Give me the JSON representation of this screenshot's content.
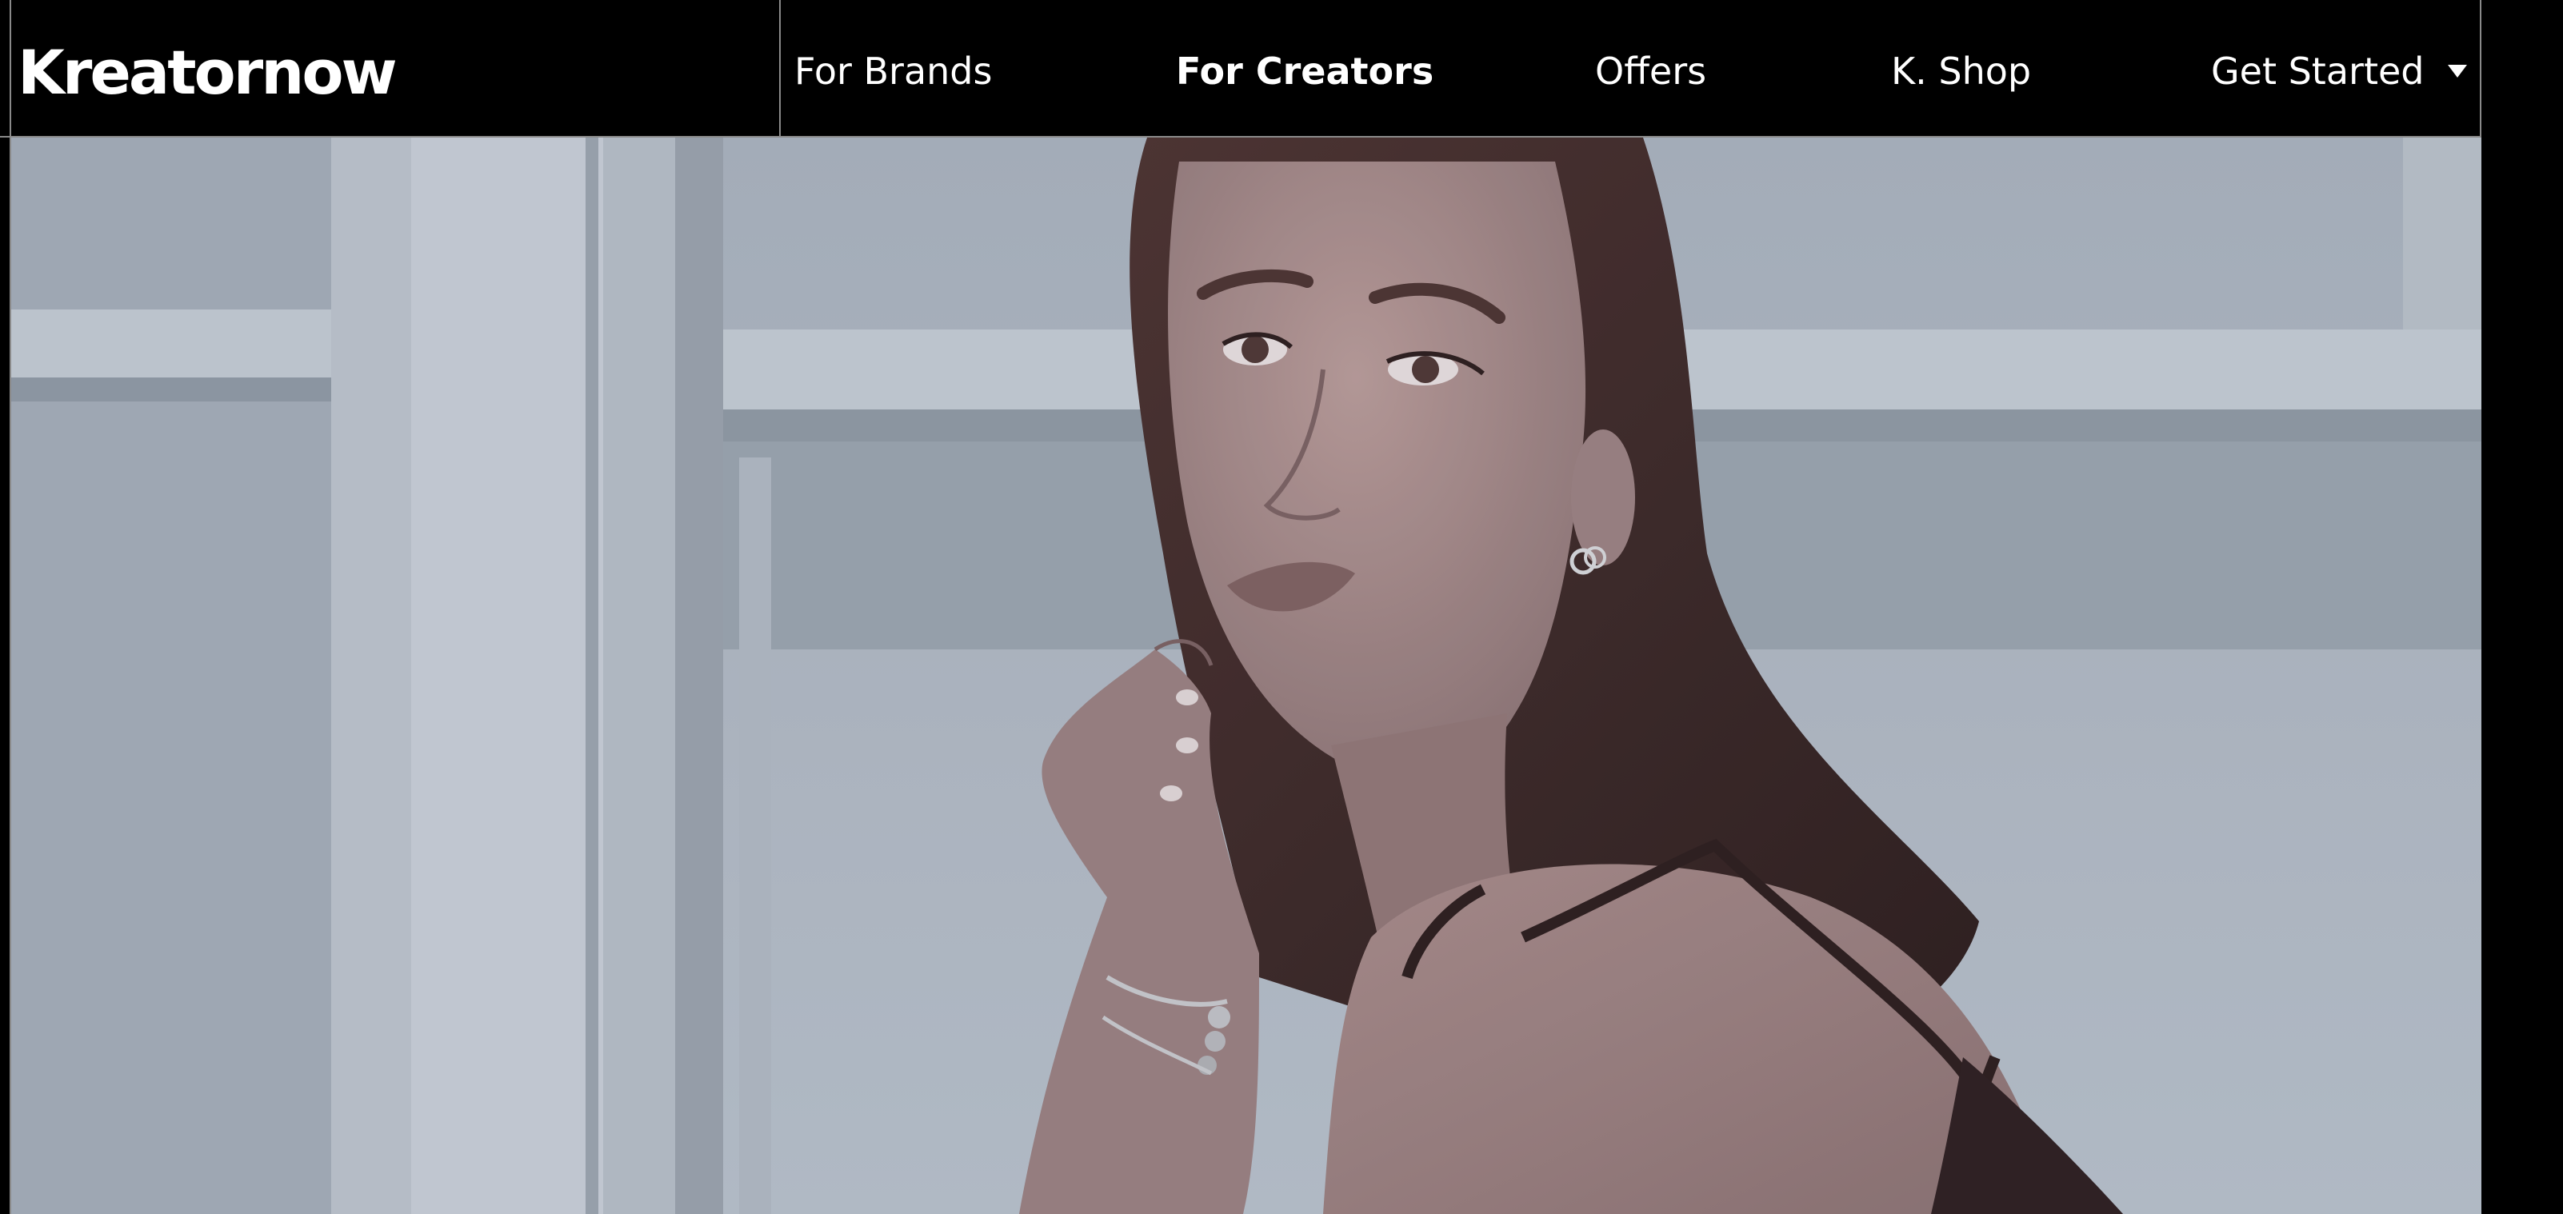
{
  "header": {
    "logo_text": "Kreatornow",
    "nav": [
      {
        "label": "For Brands",
        "active": false
      },
      {
        "label": "For Creators",
        "active": true
      },
      {
        "label": "Offers",
        "active": false
      },
      {
        "label": "K. Shop",
        "active": false
      },
      {
        "label": "Get Started",
        "active": false,
        "has_dropdown": true
      }
    ],
    "dropdown_icon": "caret-down-icon"
  },
  "hero": {
    "image_subject": "woman posing with hand near chin against white shelves"
  },
  "colors": {
    "header_bg": "#000000",
    "header_text": "#ffffff",
    "divider": "#8a8a8a",
    "hero_tint": "#aab3bf"
  }
}
